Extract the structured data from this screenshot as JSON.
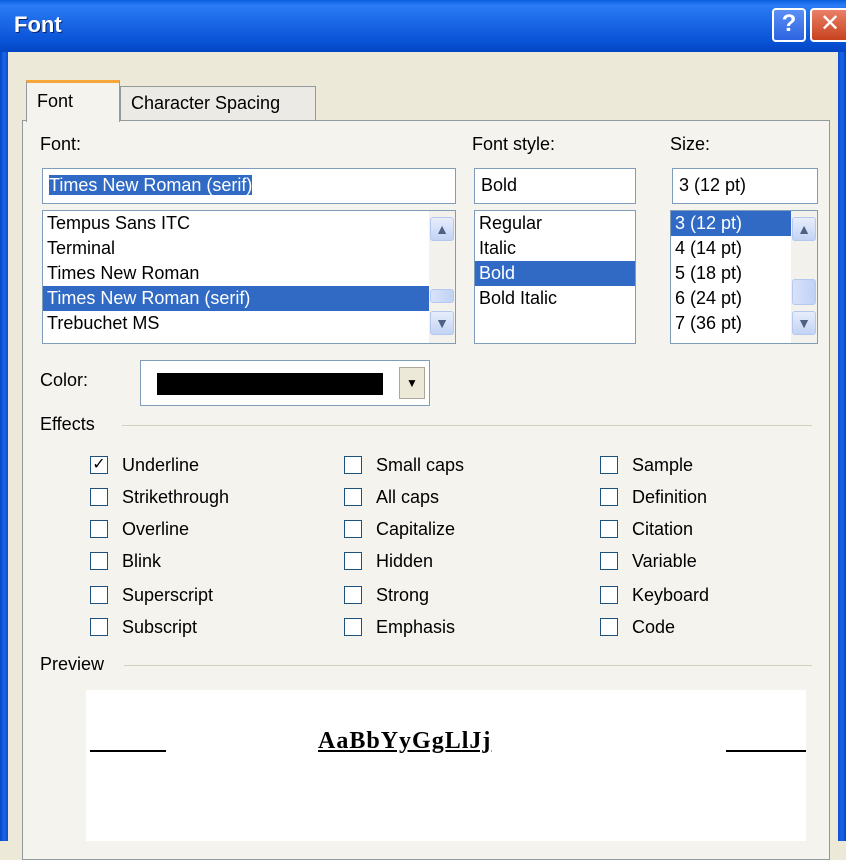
{
  "window": {
    "title": "Font",
    "help_glyph": "?",
    "close_glyph": "✕"
  },
  "tabs": [
    {
      "label": "Font",
      "active": true
    },
    {
      "label": "Character Spacing",
      "active": false
    }
  ],
  "font": {
    "label": "Font:",
    "value": "Times New Roman (serif)",
    "items": [
      "Tempus Sans ITC",
      "Terminal",
      "Times New Roman",
      "Times New Roman (serif)",
      "Trebuchet MS"
    ],
    "selected_index": 3
  },
  "style": {
    "label": "Font style:",
    "value": "Bold",
    "items": [
      "Regular",
      "Italic",
      "Bold",
      "Bold Italic"
    ],
    "selected_index": 2
  },
  "size": {
    "label": "Size:",
    "value": "3  (12 pt)",
    "items": [
      "3  (12 pt)",
      "4  (14 pt)",
      "5  (18 pt)",
      "6  (24 pt)",
      "7  (36 pt)"
    ],
    "selected_index": 0
  },
  "color": {
    "label": "Color:",
    "value_color": "#000000"
  },
  "effects": {
    "label": "Effects",
    "columns": [
      [
        {
          "label": "Underline",
          "checked": true
        },
        {
          "label": "Strikethrough",
          "checked": false
        },
        {
          "label": "Overline",
          "checked": false
        },
        {
          "label": "Blink",
          "checked": false
        },
        {
          "label": "Superscript",
          "checked": false
        },
        {
          "label": "Subscript",
          "checked": false
        }
      ],
      [
        {
          "label": "Small caps",
          "checked": false
        },
        {
          "label": "All caps",
          "checked": false
        },
        {
          "label": "Capitalize",
          "checked": false
        },
        {
          "label": "Hidden",
          "checked": false
        },
        {
          "label": "Strong",
          "checked": false
        },
        {
          "label": "Emphasis",
          "checked": false
        }
      ],
      [
        {
          "label": "Sample",
          "checked": false
        },
        {
          "label": "Definition",
          "checked": false
        },
        {
          "label": "Citation",
          "checked": false
        },
        {
          "label": "Variable",
          "checked": false
        },
        {
          "label": "Keyboard",
          "checked": false
        },
        {
          "label": "Code",
          "checked": false
        }
      ]
    ]
  },
  "preview": {
    "label": "Preview",
    "sample_text": "AaBbYyGgLlJj"
  },
  "colors": {
    "selection": "#316ac5",
    "titlebar": "#0a5fe0",
    "dialog_bg": "#ece9d8"
  }
}
